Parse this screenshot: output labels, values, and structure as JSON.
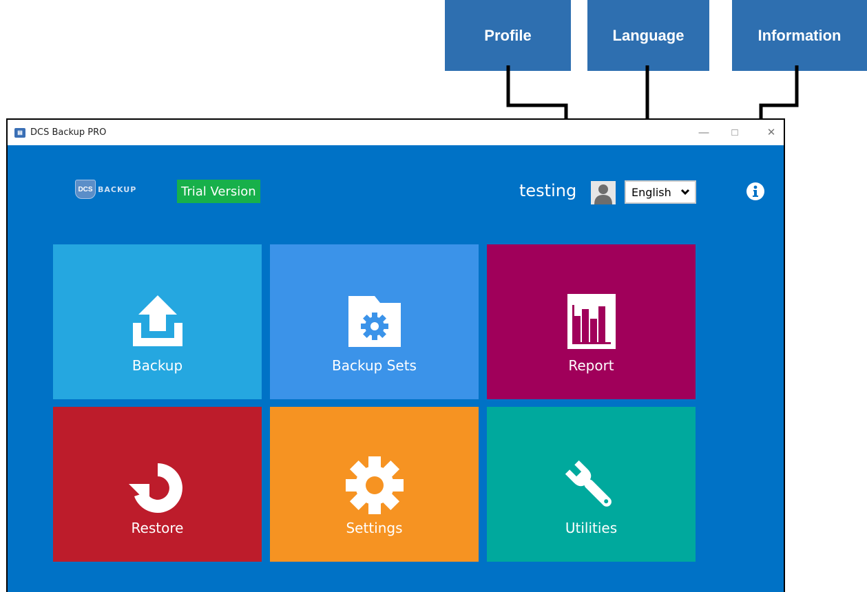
{
  "callouts": [
    {
      "label": "Profile"
    },
    {
      "label": "Language"
    },
    {
      "label": "Information"
    }
  ],
  "window": {
    "title": "DCS Backup PRO",
    "controls": [
      "minimize",
      "maximize",
      "close"
    ]
  },
  "header": {
    "logo_text": "BACKUP",
    "logo_badge": "DCS",
    "trial_label": "Trial Version",
    "username": "testing",
    "language_selected": "English"
  },
  "tiles": [
    {
      "label": "Backup",
      "icon": "upload-icon",
      "color": "#25a7e0"
    },
    {
      "label": "Backup Sets",
      "icon": "folder-gear-icon",
      "color": "#3b93e9"
    },
    {
      "label": "Report",
      "icon": "bar-chart-icon",
      "color": "#a0005a"
    },
    {
      "label": "Restore",
      "icon": "restore-icon",
      "color": "#bd1c2b"
    },
    {
      "label": "Settings",
      "icon": "gear-icon",
      "color": "#f69322"
    },
    {
      "label": "Utilities",
      "icon": "wrench-icon",
      "color": "#00a99d"
    }
  ],
  "colors": {
    "app_background": "#0072c6",
    "callout": "#2e6fb0",
    "trial": "#17b04a"
  }
}
